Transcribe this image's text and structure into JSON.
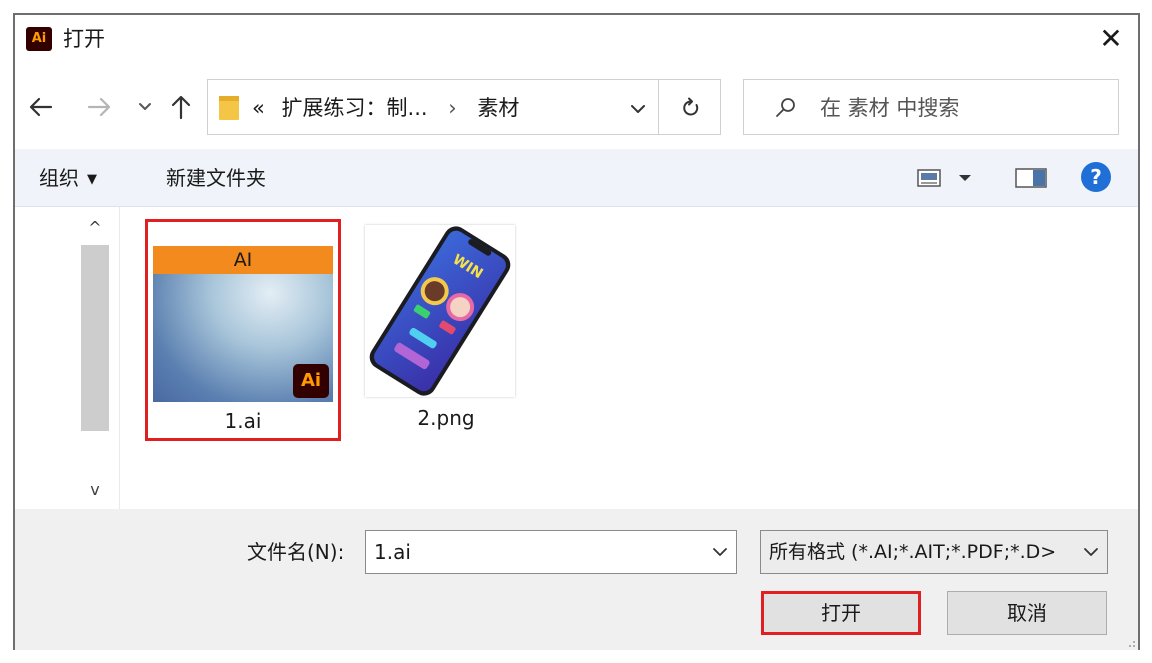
{
  "window": {
    "title": "打开",
    "app_icon_text": "Ai",
    "close_symbol": "✕"
  },
  "nav": {
    "back_icon": "arrow-left-icon",
    "forward_icon": "arrow-right-icon",
    "recent_icon": "chevron-down-icon",
    "up_icon": "arrow-up-icon"
  },
  "address": {
    "prefix": "«",
    "path": [
      "扩展练习：制...",
      "素材"
    ],
    "separator": "›"
  },
  "search": {
    "placeholder": "在 素材 中搜索"
  },
  "toolbar": {
    "organize_label": "组织",
    "organize_caret": "▼",
    "new_folder_label": "新建文件夹",
    "help_label": "?"
  },
  "files": [
    {
      "name": "1.ai",
      "thumb_banner": "AI",
      "thumb_badge": "Ai",
      "selected": true
    },
    {
      "name": "2.png",
      "thumb_text": "WIN",
      "selected": false
    }
  ],
  "scrollbar": {
    "up_symbol": "^",
    "down_symbol": "v"
  },
  "footer": {
    "filename_label": "文件名(N):",
    "filename_value": "1.ai",
    "filter_value": "所有格式 (*.AI;*.AIT;*.PDF;*.D>",
    "open_label": "打开",
    "cancel_label": "取消"
  },
  "colors": {
    "selection_outline": "#e02020",
    "ai_orange": "#f28a1e",
    "ai_badge_bg": "#330000",
    "ai_badge_fg": "#ff9a00",
    "toolbar_bg": "#f0f3f9",
    "footer_bg": "#f0f0f0",
    "help_blue": "#1f6fd6"
  }
}
